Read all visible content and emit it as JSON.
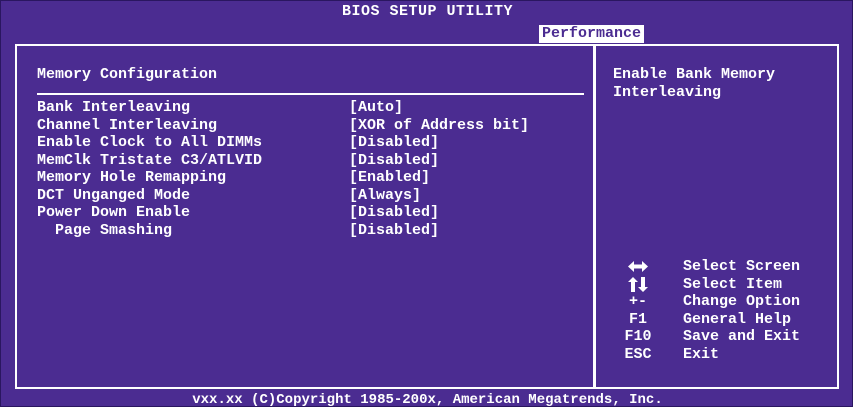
{
  "window": {
    "title": "BIOS SETUP UTILITY",
    "active_tab": "Performance"
  },
  "section": {
    "title": "Memory Configuration"
  },
  "settings": [
    {
      "label": "Bank Interleaving",
      "value": "[Auto]",
      "selected": true,
      "indent": false
    },
    {
      "label": "Channel Interleaving",
      "value": "[XOR of Address bit]",
      "selected": false,
      "indent": false
    },
    {
      "label": "Enable Clock to All DIMMs",
      "value": "[Disabled]",
      "selected": false,
      "indent": false
    },
    {
      "label": "MemClk Tristate C3/ATLVID",
      "value": "[Disabled]",
      "selected": false,
      "indent": false
    },
    {
      "label": "Memory Hole Remapping",
      "value": "[Enabled]",
      "selected": false,
      "indent": false
    },
    {
      "label": "DCT Unganged Mode",
      "value": "[Always]",
      "selected": false,
      "indent": false
    },
    {
      "label": "Power Down Enable",
      "value": "[Disabled]",
      "selected": false,
      "indent": false
    },
    {
      "label": "Page Smashing",
      "value": "[Disabled]",
      "selected": false,
      "indent": true
    }
  ],
  "help": {
    "text": "Enable Bank Memory Interleaving"
  },
  "keys": [
    {
      "key": "",
      "icon": "left-right-arrows-icon",
      "desc": "Select Screen"
    },
    {
      "key": "",
      "icon": "up-down-arrows-icon",
      "desc": "Select Item"
    },
    {
      "key": "+-",
      "icon": "",
      "desc": "Change Option"
    },
    {
      "key": "F1",
      "icon": "",
      "desc": "General Help"
    },
    {
      "key": "F10",
      "icon": "",
      "desc": "Save and Exit"
    },
    {
      "key": "ESC",
      "icon": "",
      "desc": "Exit"
    }
  ],
  "footer": {
    "text": "vxx.xx (C)Copyright 1985-200x, American Megatrends, Inc."
  },
  "colors": {
    "background": "#4b2c91",
    "text": "#ffffff",
    "tab_bg": "#ffffff"
  }
}
